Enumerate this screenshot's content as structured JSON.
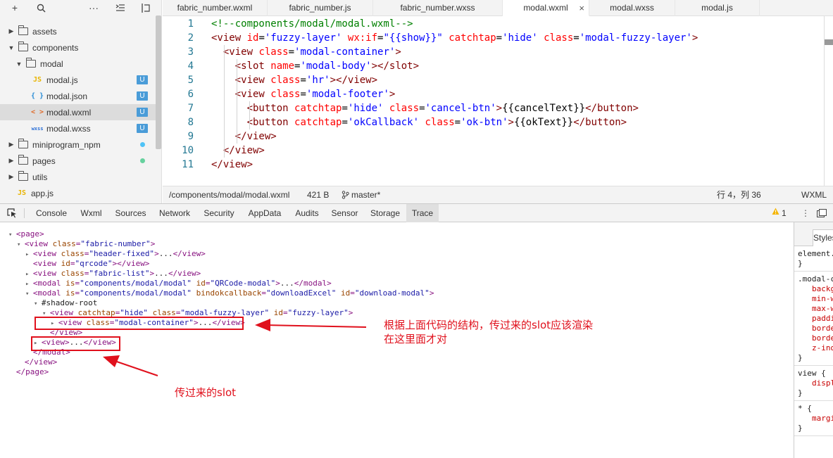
{
  "toolbar": {
    "icons": [
      "plus-icon",
      "search-icon",
      "more-icon",
      "collapse-icon",
      "split-icon"
    ]
  },
  "tree": [
    {
      "name": "assets",
      "type": "folder",
      "expanded": false
    },
    {
      "name": "components",
      "type": "folder",
      "expanded": true
    },
    {
      "name": "modal",
      "type": "folder",
      "expanded": true
    },
    {
      "name": "modal.js",
      "type": "js",
      "icon": "JS",
      "badge": "U"
    },
    {
      "name": "modal.json",
      "type": "json",
      "icon": "{ }",
      "badge": "U"
    },
    {
      "name": "modal.wxml",
      "type": "wxml",
      "icon": "< >",
      "badge": "U",
      "selected": true
    },
    {
      "name": "modal.wxss",
      "type": "wxss",
      "icon": "wxss",
      "badge": "U"
    },
    {
      "name": "miniprogram_npm",
      "type": "folder",
      "expanded": false,
      "dot": "#4fc3f7"
    },
    {
      "name": "pages",
      "type": "folder",
      "expanded": false,
      "dot": "#66d19e"
    },
    {
      "name": "utils",
      "type": "folder",
      "expanded": false
    },
    {
      "name": "app.js",
      "type": "js",
      "icon": "JS"
    }
  ],
  "tabs": [
    {
      "label": "fabric_number.wxml"
    },
    {
      "label": "fabric_number.js"
    },
    {
      "label": "fabric_number.wxss"
    },
    {
      "label": "modal.wxml",
      "active": true,
      "close": "×"
    },
    {
      "label": "modal.wxss"
    },
    {
      "label": "modal.js"
    }
  ],
  "editor": {
    "lines": [
      {
        "n": "1",
        "tokens": [
          [
            "c-com",
            "<!--components/modal/modal.wxml-->"
          ]
        ]
      },
      {
        "n": "2",
        "tokens": [
          [
            "c-tag",
            "<view "
          ],
          [
            "c-att",
            "id"
          ],
          [
            "c-txt",
            "="
          ],
          [
            "c-str",
            "'fuzzy-layer'"
          ],
          [
            "c-txt",
            " "
          ],
          [
            "c-att",
            "wx:if"
          ],
          [
            "c-txt",
            "="
          ],
          [
            "c-str",
            "\"{{show}}\""
          ],
          [
            "c-txt",
            " "
          ],
          [
            "c-att",
            "catchtap"
          ],
          [
            "c-txt",
            "="
          ],
          [
            "c-str",
            "'hide'"
          ],
          [
            "c-txt",
            " "
          ],
          [
            "c-att",
            "class"
          ],
          [
            "c-txt",
            "="
          ],
          [
            "c-str",
            "'modal-fuzzy-layer'"
          ],
          [
            "c-tag",
            ">"
          ]
        ]
      },
      {
        "n": "3",
        "tokens": [
          [
            "c-txt",
            "  "
          ],
          [
            "c-tag",
            "<view "
          ],
          [
            "c-att",
            "class"
          ],
          [
            "c-txt",
            "="
          ],
          [
            "c-str",
            "'modal-container'"
          ],
          [
            "c-tag",
            ">"
          ]
        ]
      },
      {
        "n": "4",
        "tokens": [
          [
            "c-txt",
            "    "
          ],
          [
            "c-tag",
            "<slot "
          ],
          [
            "c-att",
            "name"
          ],
          [
            "c-txt",
            "="
          ],
          [
            "c-str",
            "'modal-body'"
          ],
          [
            "c-tag",
            "></slot>"
          ]
        ]
      },
      {
        "n": "5",
        "tokens": [
          [
            "c-txt",
            "    "
          ],
          [
            "c-tag",
            "<view "
          ],
          [
            "c-att",
            "class"
          ],
          [
            "c-txt",
            "="
          ],
          [
            "c-str",
            "'hr'"
          ],
          [
            "c-tag",
            "></view>"
          ]
        ]
      },
      {
        "n": "6",
        "tokens": [
          [
            "c-txt",
            "    "
          ],
          [
            "c-tag",
            "<view "
          ],
          [
            "c-att",
            "class"
          ],
          [
            "c-txt",
            "="
          ],
          [
            "c-str",
            "'modal-footer'"
          ],
          [
            "c-tag",
            ">"
          ]
        ]
      },
      {
        "n": "7",
        "tokens": [
          [
            "c-txt",
            "      "
          ],
          [
            "c-tag",
            "<button "
          ],
          [
            "c-att",
            "catchtap"
          ],
          [
            "c-txt",
            "="
          ],
          [
            "c-str",
            "'hide'"
          ],
          [
            "c-txt",
            " "
          ],
          [
            "c-att",
            "class"
          ],
          [
            "c-txt",
            "="
          ],
          [
            "c-str",
            "'cancel-btn'"
          ],
          [
            "c-tag",
            ">"
          ],
          [
            "c-txt",
            "{{cancelText}}"
          ],
          [
            "c-tag",
            "</button>"
          ]
        ]
      },
      {
        "n": "8",
        "tokens": [
          [
            "c-txt",
            "      "
          ],
          [
            "c-tag",
            "<button "
          ],
          [
            "c-att",
            "catchtap"
          ],
          [
            "c-txt",
            "="
          ],
          [
            "c-str",
            "'okCallback'"
          ],
          [
            "c-txt",
            " "
          ],
          [
            "c-att",
            "class"
          ],
          [
            "c-txt",
            "="
          ],
          [
            "c-str",
            "'ok-btn'"
          ],
          [
            "c-tag",
            ">"
          ],
          [
            "c-txt",
            "{{okText}}"
          ],
          [
            "c-tag",
            "</button>"
          ]
        ]
      },
      {
        "n": "9",
        "tokens": [
          [
            "c-txt",
            "    "
          ],
          [
            "c-tag",
            "</view>"
          ]
        ]
      },
      {
        "n": "10",
        "tokens": [
          [
            "c-txt",
            "  "
          ],
          [
            "c-tag",
            "</view>"
          ]
        ]
      },
      {
        "n": "11",
        "tokens": [
          [
            "c-tag",
            "</view>"
          ]
        ]
      }
    ]
  },
  "status": {
    "path": "/components/modal/modal.wxml",
    "size": "421 B",
    "branch": "master*",
    "position": "行 4，列 36",
    "lang": "WXML"
  },
  "devtools": {
    "tabs": [
      "Console",
      "Wxml",
      "Sources",
      "Network",
      "Security",
      "AppData",
      "Audits",
      "Sensor",
      "Storage",
      "Trace"
    ],
    "selected_tab": "Trace",
    "warning": "1",
    "dom": [
      {
        "tri": "▾",
        "parts": [
          [
            "tn",
            "<page>"
          ]
        ]
      },
      {
        "tri": "▾",
        "parts": [
          [
            "tn",
            "<view "
          ],
          [
            "an",
            "class"
          ],
          [
            "tn",
            "="
          ],
          [
            "av",
            "\"fabric-number\""
          ],
          [
            "tn",
            ">"
          ]
        ]
      },
      {
        "tri": "▸",
        "parts": [
          [
            "tn",
            "<view "
          ],
          [
            "an",
            "class"
          ],
          [
            "tn",
            "="
          ],
          [
            "av",
            "\"header-fixed\""
          ],
          [
            "tn",
            ">"
          ],
          [
            "tx",
            "..."
          ],
          [
            "tn",
            "</view>"
          ]
        ]
      },
      {
        "tri": "",
        "parts": [
          [
            "tn",
            "<view "
          ],
          [
            "an",
            "id"
          ],
          [
            "tn",
            "="
          ],
          [
            "av",
            "\"qrcode\""
          ],
          [
            "tn",
            "></view>"
          ]
        ]
      },
      {
        "tri": "▸",
        "parts": [
          [
            "tn",
            "<view "
          ],
          [
            "an",
            "class"
          ],
          [
            "tn",
            "="
          ],
          [
            "av",
            "\"fabric-list\""
          ],
          [
            "tn",
            ">"
          ],
          [
            "tx",
            "..."
          ],
          [
            "tn",
            "</view>"
          ]
        ]
      },
      {
        "tri": "▸",
        "parts": [
          [
            "tn",
            "<modal "
          ],
          [
            "an",
            "is"
          ],
          [
            "tn",
            "="
          ],
          [
            "av",
            "\"components/modal/modal\""
          ],
          [
            "tn",
            " "
          ],
          [
            "an",
            "id"
          ],
          [
            "tn",
            "="
          ],
          [
            "av",
            "\"QRCode-modal\""
          ],
          [
            "tn",
            ">"
          ],
          [
            "tx",
            "..."
          ],
          [
            "tn",
            "</modal>"
          ]
        ]
      },
      {
        "tri": "▾",
        "parts": [
          [
            "tn",
            "<modal "
          ],
          [
            "an",
            "is"
          ],
          [
            "tn",
            "="
          ],
          [
            "av",
            "\"components/modal/modal\""
          ],
          [
            "tn",
            " "
          ],
          [
            "an",
            "bindokcallback"
          ],
          [
            "tn",
            "="
          ],
          [
            "av",
            "\"downloadExcel\""
          ],
          [
            "tn",
            " "
          ],
          [
            "an",
            "id"
          ],
          [
            "tn",
            "="
          ],
          [
            "av",
            "\"download-modal\""
          ],
          [
            "tn",
            ">"
          ]
        ]
      },
      {
        "tri": "▾",
        "parts": [
          [
            "tx",
            "#shadow-root"
          ]
        ]
      },
      {
        "tri": "▾",
        "parts": [
          [
            "tn",
            "<view "
          ],
          [
            "an",
            "catchtap"
          ],
          [
            "tn",
            "="
          ],
          [
            "av",
            "\"hide\""
          ],
          [
            "tn",
            " "
          ],
          [
            "an",
            "class"
          ],
          [
            "tn",
            "="
          ],
          [
            "av",
            "\"modal-fuzzy-layer\""
          ],
          [
            "tn",
            " "
          ],
          [
            "an",
            "id"
          ],
          [
            "tn",
            "="
          ],
          [
            "av",
            "\"fuzzy-layer\""
          ],
          [
            "tn",
            ">"
          ]
        ]
      },
      {
        "tri": "▸",
        "parts": [
          [
            "tn",
            "<view "
          ],
          [
            "an",
            "class"
          ],
          [
            "tn",
            "="
          ],
          [
            "av",
            "\"modal-container\""
          ],
          [
            "tn",
            ">"
          ],
          [
            "tx",
            "..."
          ],
          [
            "tn",
            "</view>"
          ]
        ]
      },
      {
        "tri": "",
        "parts": [
          [
            "tn",
            "</view>"
          ]
        ]
      },
      {
        "tri": "▸",
        "parts": [
          [
            "tn",
            "<view>"
          ],
          [
            "tx",
            "..."
          ],
          [
            "tn",
            "</view>"
          ]
        ]
      },
      {
        "tri": "",
        "parts": [
          [
            "tn",
            "</modal>"
          ]
        ]
      },
      {
        "tri": "",
        "parts": [
          [
            "tn",
            "</view>"
          ]
        ]
      },
      {
        "tri": "",
        "parts": [
          [
            "tn",
            "</page>"
          ]
        ]
      }
    ],
    "styles_tab": "Styles",
    "styles": [
      {
        "kind": "sel",
        "text": "element.style {"
      },
      {
        "kind": "sel",
        "text": "}"
      },
      {
        "kind": "sel",
        "text": ".modal-container {"
      },
      {
        "kind": "prop",
        "text": "background"
      },
      {
        "kind": "prop",
        "text": "min-width"
      },
      {
        "kind": "prop",
        "text": "max-width"
      },
      {
        "kind": "prop",
        "text": "padding"
      },
      {
        "kind": "prop",
        "text": "border"
      },
      {
        "kind": "prop",
        "text": "border-radius"
      },
      {
        "kind": "prop",
        "text": "z-index"
      },
      {
        "kind": "sel",
        "text": "}"
      },
      {
        "kind": "sel",
        "text": "view {"
      },
      {
        "kind": "prop",
        "text": "display"
      },
      {
        "kind": "sel",
        "text": "}"
      },
      {
        "kind": "sel",
        "text": "* {"
      },
      {
        "kind": "prop",
        "text": "margin"
      },
      {
        "kind": "sel",
        "text": "}"
      }
    ]
  },
  "annotations": {
    "note1": "根据上面代码的结构，传过来的slot应该渲染",
    "note1b": "在这里面才对",
    "note2": "传过来的slot",
    "color": "#e0101c"
  }
}
